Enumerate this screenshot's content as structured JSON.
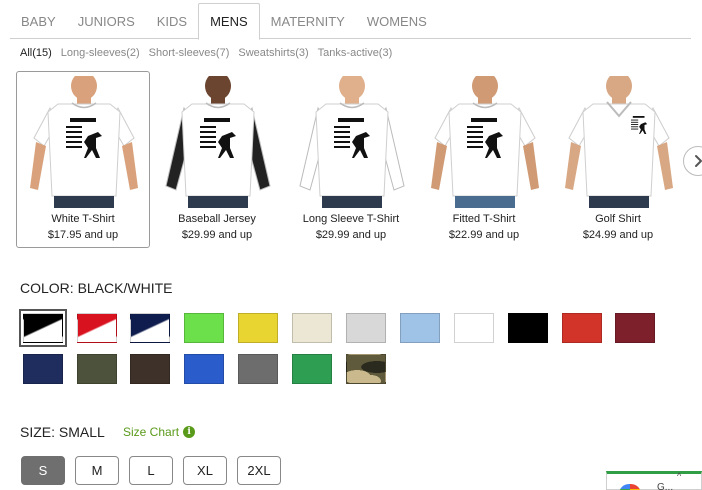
{
  "tabs": [
    {
      "label": "BABY",
      "active": false
    },
    {
      "label": "JUNIORS",
      "active": false
    },
    {
      "label": "KIDS",
      "active": false
    },
    {
      "label": "MENS",
      "active": true
    },
    {
      "label": "MATERNITY",
      "active": false
    },
    {
      "label": "WOMENS",
      "active": false
    }
  ],
  "subfilters": [
    {
      "label": "All(15)",
      "active": true
    },
    {
      "label": "Long-sleeves(2)",
      "active": false
    },
    {
      "label": "Short-sleeves(7)",
      "active": false
    },
    {
      "label": "Sweatshirts(3)",
      "active": false
    },
    {
      "label": "Tanks-active(3)",
      "active": false
    }
  ],
  "products": [
    {
      "name": "White T-Shirt",
      "price": "$17.95 and up",
      "selected": true,
      "style": "tee",
      "body_color": "#ffffff",
      "sleeve_color": "#ffffff",
      "skin": "#d9a27c"
    },
    {
      "name": "Baseball Jersey",
      "price": "$29.99 and up",
      "selected": false,
      "style": "raglan",
      "body_color": "#ffffff",
      "sleeve_color": "#222222",
      "skin": "#6b4530"
    },
    {
      "name": "Long Sleeve T-Shirt",
      "price": "$29.99 and up",
      "selected": false,
      "style": "longsleeve",
      "body_color": "#ffffff",
      "sleeve_color": "#ffffff",
      "skin": "#e0b08c"
    },
    {
      "name": "Fitted T-Shirt",
      "price": "$22.99 and up",
      "selected": false,
      "style": "tee",
      "body_color": "#ffffff",
      "sleeve_color": "#ffffff",
      "skin": "#cf9a74"
    },
    {
      "name": "Golf Shirt",
      "price": "$24.99 and up",
      "selected": false,
      "style": "polo",
      "body_color": "#ffffff",
      "sleeve_color": "#ffffff",
      "skin": "#d8a784"
    }
  ],
  "next_icon": "chevron-right-icon",
  "color": {
    "title": "COLOR: BLACK/WHITE",
    "swatches": [
      {
        "name": "black-white",
        "fill": "diag",
        "c1": "#000000",
        "c2": "#ffffff",
        "selected": true
      },
      {
        "name": "red-white",
        "fill": "diag",
        "c1": "#d9121f",
        "c2": "#ffffff",
        "selected": false
      },
      {
        "name": "navy-white",
        "fill": "diag",
        "c1": "#0e1d4d",
        "c2": "#ffffff",
        "selected": false
      },
      {
        "name": "lime",
        "fill": "solid",
        "c1": "#6be04a",
        "selected": false
      },
      {
        "name": "yellow",
        "fill": "solid",
        "c1": "#e9d531",
        "selected": false
      },
      {
        "name": "natural",
        "fill": "solid",
        "c1": "#ece7d4",
        "selected": false
      },
      {
        "name": "ash-grey",
        "fill": "solid",
        "c1": "#d8d8d8",
        "selected": false
      },
      {
        "name": "light-blue",
        "fill": "solid",
        "c1": "#9fc2e7",
        "selected": false
      },
      {
        "name": "white",
        "fill": "solid",
        "c1": "#ffffff",
        "selected": false
      },
      {
        "name": "black",
        "fill": "solid",
        "c1": "#000000",
        "selected": false
      },
      {
        "name": "red",
        "fill": "solid",
        "c1": "#d3342a",
        "selected": false
      },
      {
        "name": "maroon",
        "fill": "solid",
        "c1": "#7e1f2c",
        "selected": false
      },
      {
        "name": "navy",
        "fill": "solid",
        "c1": "#1f2d5e",
        "selected": false
      },
      {
        "name": "military-green",
        "fill": "solid",
        "c1": "#4c523b",
        "selected": false
      },
      {
        "name": "brown",
        "fill": "solid",
        "c1": "#3d3129",
        "selected": false
      },
      {
        "name": "royal-blue",
        "fill": "solid",
        "c1": "#2a5dcb",
        "selected": false
      },
      {
        "name": "charcoal",
        "fill": "solid",
        "c1": "#6d6d6d",
        "selected": false
      },
      {
        "name": "kelly-green",
        "fill": "solid",
        "c1": "#2e9e52",
        "selected": false
      },
      {
        "name": "camo",
        "fill": "camo",
        "c1": "#5f5a3b",
        "c2": "#c9b98c",
        "c3": "#2b2a1e",
        "selected": false
      }
    ]
  },
  "size": {
    "title": "SIZE: SMALL",
    "chart_label": "Size Chart",
    "chart_icon": "info-icon",
    "chart_icon_glyph": "i",
    "options": [
      {
        "label": "S",
        "selected": true
      },
      {
        "label": "M",
        "selected": false
      },
      {
        "label": "L",
        "selected": false
      },
      {
        "label": "XL",
        "selected": false
      },
      {
        "label": "2XL",
        "selected": false
      }
    ]
  },
  "corner_widget": {
    "icon": "chevron-up-icon",
    "glyph": "^",
    "text": "G..."
  },
  "colors": {
    "accent_green": "#5a9a1a",
    "tab_border": "#cfcfcf",
    "selected_size_bg": "#6f6f6f"
  }
}
